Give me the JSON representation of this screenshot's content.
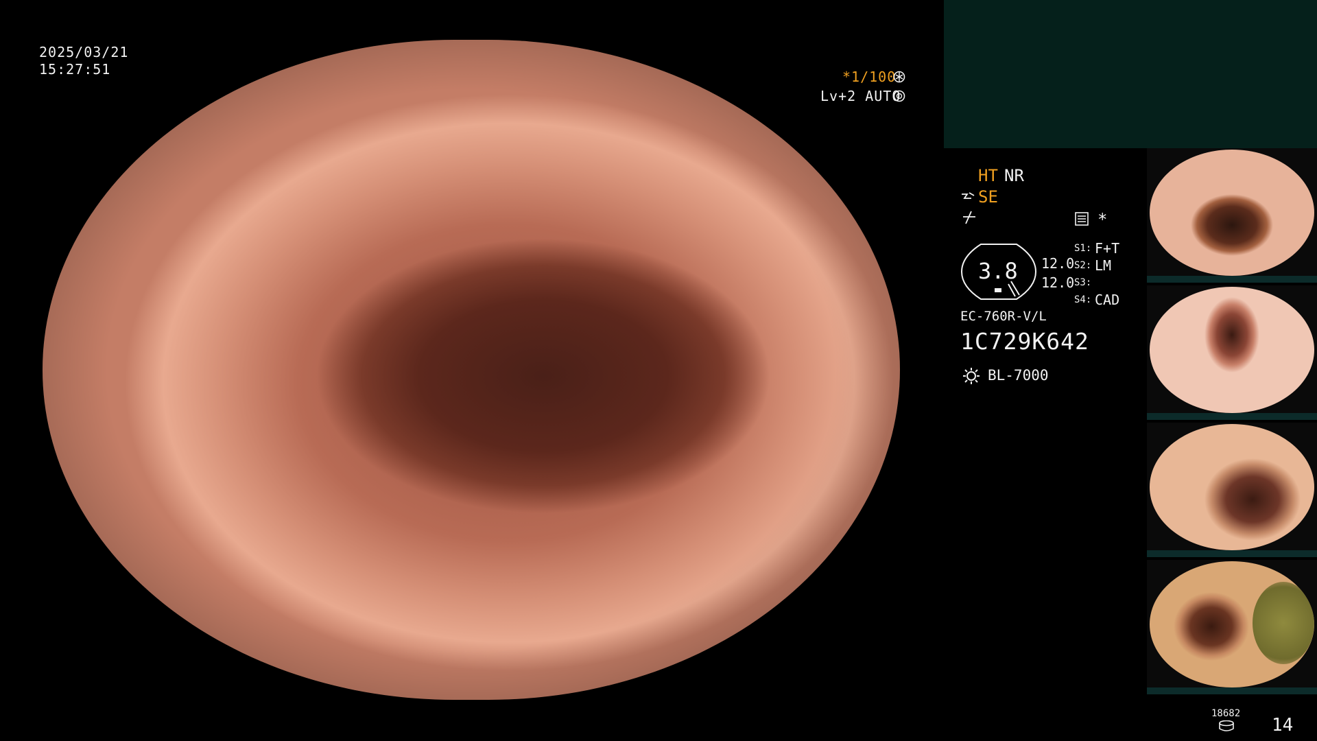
{
  "overlay": {
    "date": "2025/03/21",
    "time": "15:27:51",
    "shutter": "*1/100",
    "level": "Lv+2 AUTO"
  },
  "side": {
    "ht": "HT",
    "nr": "NR",
    "se": "SE",
    "star": "*",
    "gauge_value": "3.8",
    "val_a": "12.0",
    "val_b": "12.0",
    "s1_label": "S1:",
    "s1_value": "F+T",
    "s2_label": "S2:",
    "s2_value": "LM",
    "s3_label": "S3:",
    "s3_value": "",
    "s4_label": "S4:",
    "s4_value": "CAD",
    "scope_model": "EC-760R-V/L",
    "serial": "1C729K642",
    "light_source": "BL-7000"
  },
  "footer": {
    "storage_count": "18682",
    "image_count": "14"
  },
  "thumbnails": [
    "thumbnail-1",
    "thumbnail-2",
    "thumbnail-3",
    "thumbnail-4"
  ],
  "colors": {
    "accent": "#f0a020",
    "panel": "#05201b",
    "text": "#f2f2f2"
  }
}
